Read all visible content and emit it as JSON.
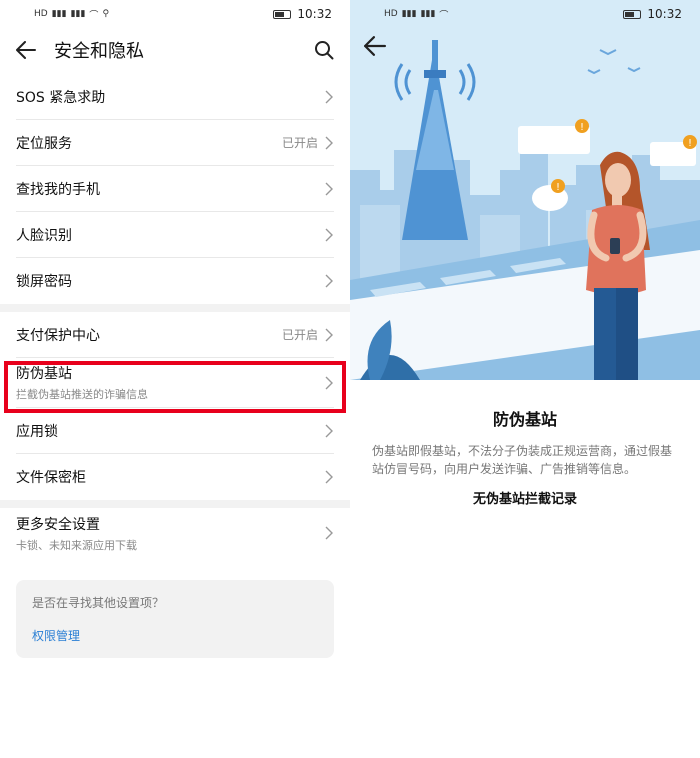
{
  "status_bar": {
    "time": "10:32",
    "carrier_icons": "HD 4G 4G"
  },
  "left_screen": {
    "title": "安全和隐私",
    "groups": [
      [
        {
          "label": "SOS 紧急求助",
          "status": ""
        },
        {
          "label": "定位服务",
          "status": "已开启"
        },
        {
          "label": "查找我的手机",
          "status": ""
        },
        {
          "label": "人脸识别",
          "status": ""
        },
        {
          "label": "锁屏密码",
          "status": ""
        }
      ],
      [
        {
          "label": "支付保护中心",
          "status": "已开启"
        },
        {
          "label": "防伪基站",
          "sub": "拦截伪基站推送的诈骗信息",
          "status": ""
        },
        {
          "label": "应用锁",
          "status": ""
        },
        {
          "label": "文件保密柜",
          "status": ""
        }
      ],
      [
        {
          "label": "更多安全设置",
          "sub": "卡锁、未知来源应用下载",
          "status": ""
        }
      ]
    ],
    "finder": {
      "question": "是否在寻找其他设置项？",
      "link": "权限管理"
    }
  },
  "right_screen": {
    "title": "防伪基站",
    "description": "伪基站即假基站，不法分子伪装成正规运营商，通过假基站仿冒号码，向用户发送诈骗、广告推销等信息。",
    "record": "无伪基站拦截记录"
  },
  "colors": {
    "highlight": "#e8001c",
    "link": "#2a7fd4",
    "sky": "#cfe6f7",
    "accent": "#f0a020"
  }
}
